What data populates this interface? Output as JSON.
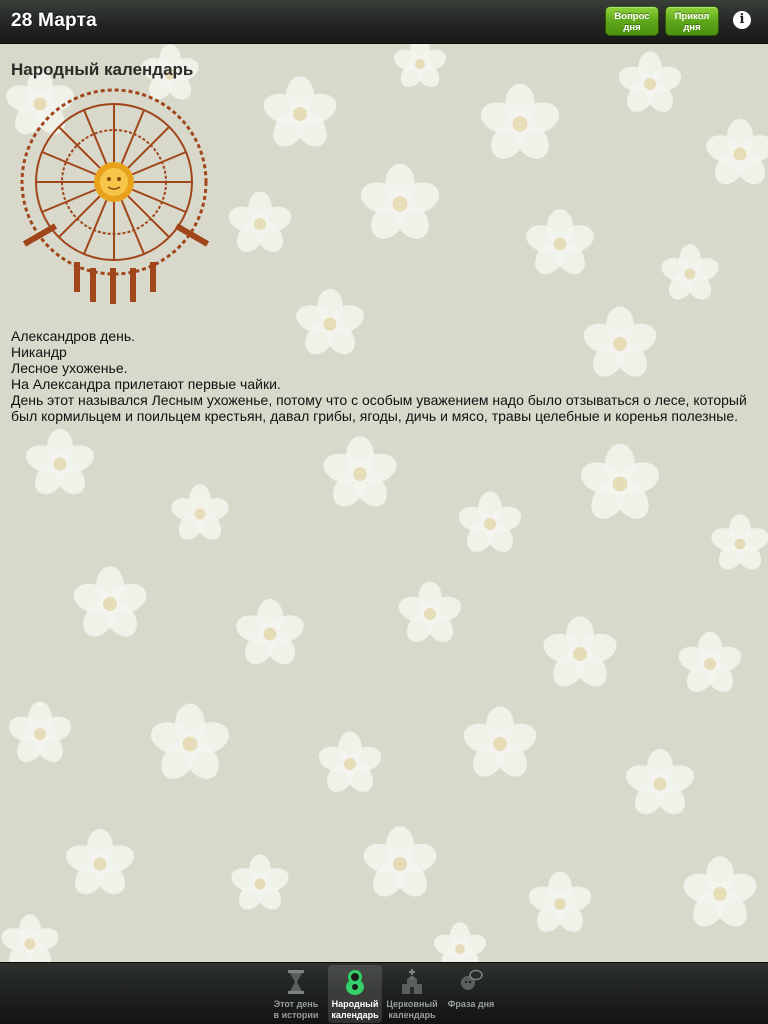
{
  "header": {
    "date_title": "28 Марта",
    "buttons": [
      {
        "line1": "Вопрос",
        "line2": "дня"
      },
      {
        "line1": "Прикол",
        "line2": "дня"
      }
    ],
    "info_icon": "info-icon"
  },
  "content": {
    "heading": "Народный календарь",
    "emblem": "sun-zodiac-emblem",
    "lines": [
      "Александров день.",
      "Никандр",
      "Лесное ухоженье.",
      "На Александра прилетают первые чайки.",
      "День этот назывался Лесным ухоженье, потому что с особым уважением надо было отзываться о лесе, который был кормильцем и поильцем крестьян, давал грибы, ягоды, дичь и мясо, травы целебные и коренья полезные."
    ]
  },
  "tabs": [
    {
      "line1": "Этот день",
      "line2": "в истории",
      "icon": "hourglass-icon",
      "active": false
    },
    {
      "line1": "Народный",
      "line2": "календарь",
      "icon": "matryoshka-icon",
      "active": true
    },
    {
      "line1": "Церковный",
      "line2": "календарь",
      "icon": "church-icon",
      "active": false
    },
    {
      "line1": "Фраза дня",
      "line2": "",
      "icon": "speech-bubble-icon",
      "active": false
    }
  ],
  "colors": {
    "accent_green": "#5fa81b",
    "active_tab_icon": "#35d06a",
    "bar_dark": "#1e211e",
    "emblem_brown": "#a0461a"
  }
}
